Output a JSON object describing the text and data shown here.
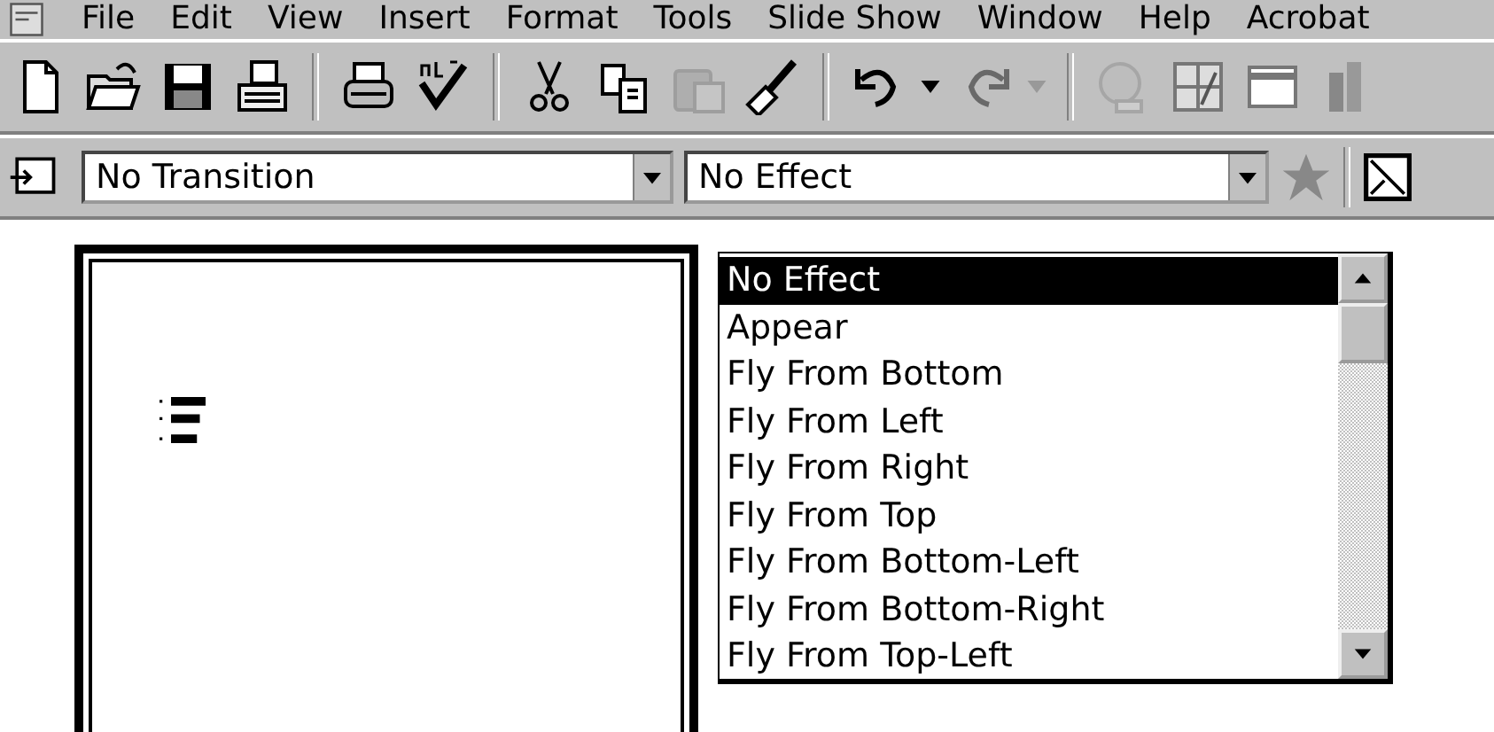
{
  "menu": [
    {
      "label": "File"
    },
    {
      "label": "Edit"
    },
    {
      "label": "View"
    },
    {
      "label": "Insert"
    },
    {
      "label": "Format"
    },
    {
      "label": "Tools"
    },
    {
      "label": "Slide Show"
    },
    {
      "label": "Window"
    },
    {
      "label": "Help"
    },
    {
      "label": "Acrobat"
    }
  ],
  "toolbar": [
    {
      "kind": "new",
      "disabled": false
    },
    {
      "kind": "open",
      "disabled": false
    },
    {
      "kind": "save",
      "disabled": false
    },
    {
      "kind": "mail",
      "disabled": false
    },
    {
      "kind": "sep"
    },
    {
      "kind": "print",
      "disabled": false
    },
    {
      "kind": "spell",
      "disabled": false
    },
    {
      "kind": "sep"
    },
    {
      "kind": "cut",
      "disabled": false
    },
    {
      "kind": "copy",
      "disabled": false
    },
    {
      "kind": "paste",
      "disabled": true
    },
    {
      "kind": "brush",
      "disabled": false
    },
    {
      "kind": "sep"
    },
    {
      "kind": "undo",
      "disabled": false
    },
    {
      "kind": "redo",
      "disabled": true
    },
    {
      "kind": "sep"
    },
    {
      "kind": "link",
      "disabled": true
    },
    {
      "kind": "table",
      "disabled": false
    },
    {
      "kind": "frame",
      "disabled": false
    },
    {
      "kind": "chart",
      "disabled": false
    }
  ],
  "transition": {
    "value": "No Transition"
  },
  "effect": {
    "value": "No Effect",
    "list": [
      {
        "label": "No Effect",
        "selected": true
      },
      {
        "label": "Appear",
        "selected": false
      },
      {
        "label": "Fly From Bottom",
        "selected": false
      },
      {
        "label": "Fly From Left",
        "selected": false
      },
      {
        "label": "Fly From Right",
        "selected": false
      },
      {
        "label": "Fly From Top",
        "selected": false
      },
      {
        "label": "Fly From Bottom-Left",
        "selected": false
      },
      {
        "label": "Fly From Bottom-Right",
        "selected": false
      },
      {
        "label": "Fly From Top-Left",
        "selected": false
      }
    ]
  }
}
